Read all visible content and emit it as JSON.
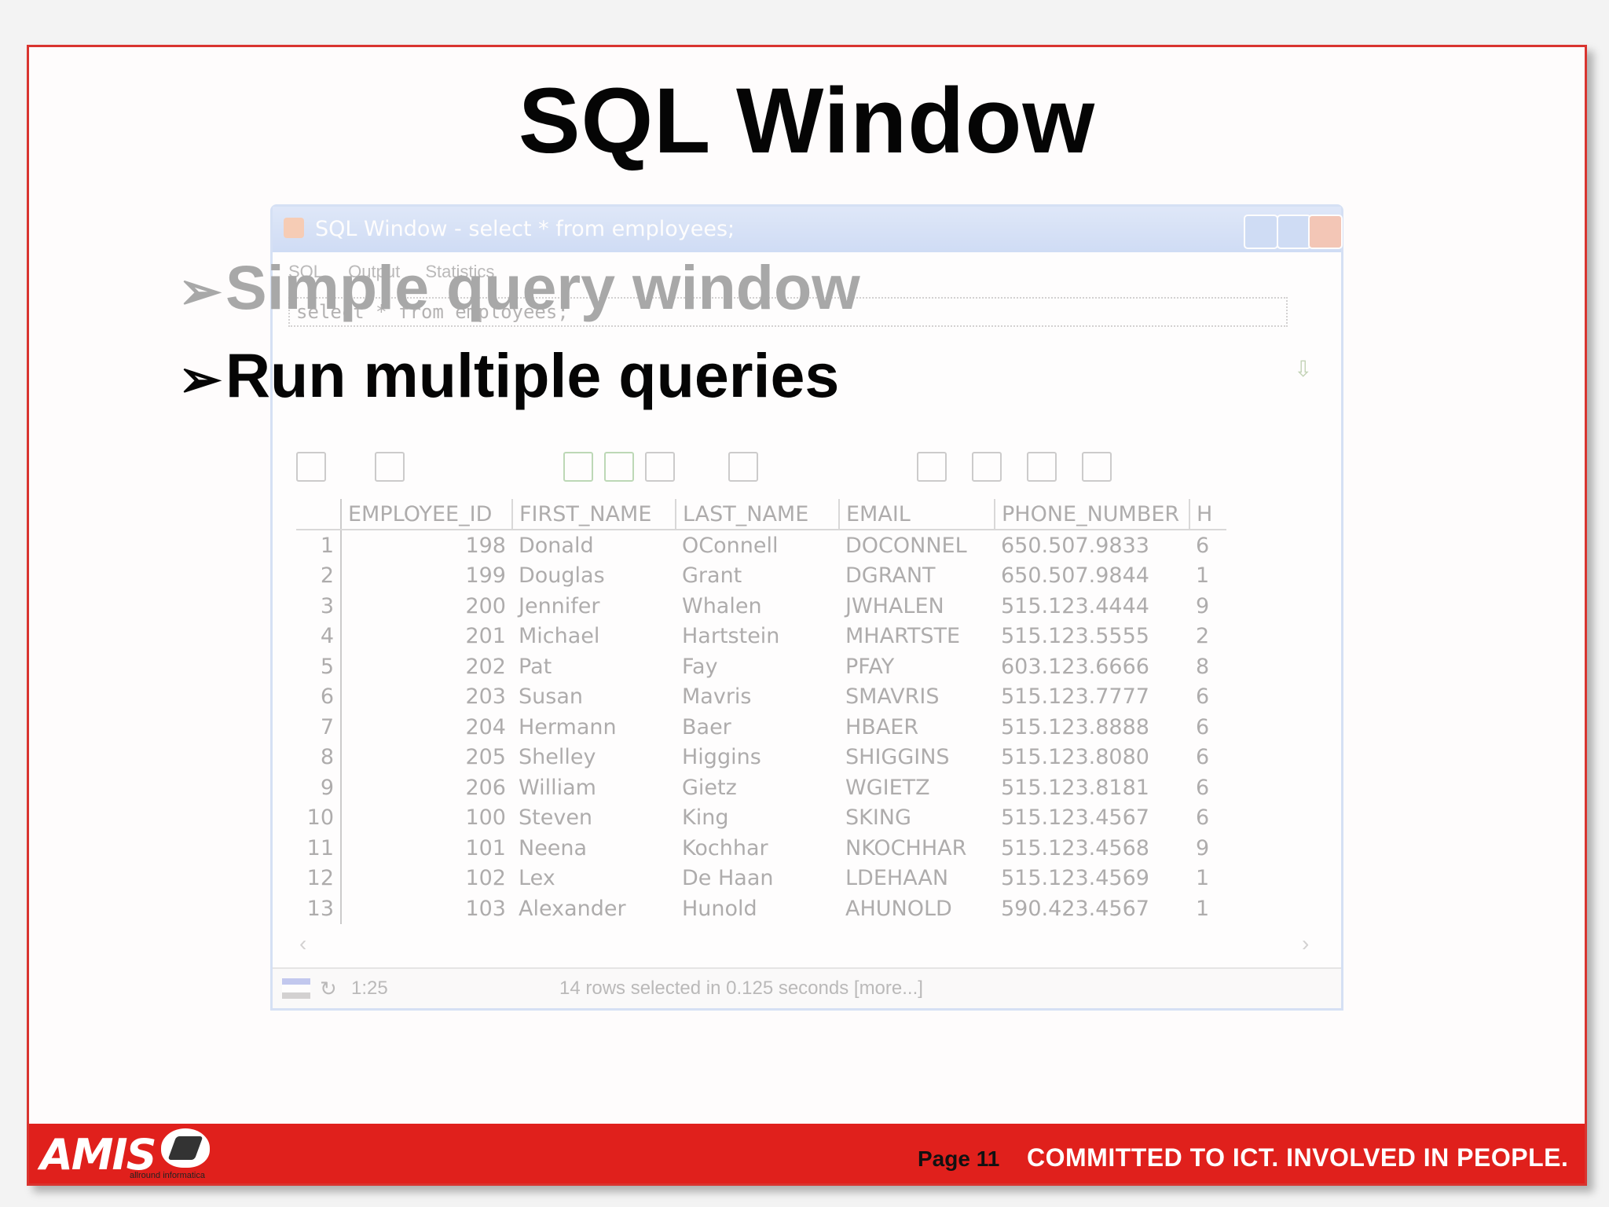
{
  "slide": {
    "title": "SQL Window",
    "bullets": [
      {
        "marker": "➢",
        "text": "Simple query window",
        "state": "faded"
      },
      {
        "marker": "➢",
        "text": "Run multiple queries",
        "state": "active"
      }
    ],
    "footer": {
      "logo_text": "AMIS",
      "logo_sub": "allround informatica",
      "page_label": "Page 11",
      "slogan": "COMMITTED TO ICT.  INVOLVED IN PEOPLE."
    }
  },
  "sql_window": {
    "title": "SQL Window - select * from employees;",
    "tabs": [
      "SQL",
      "Output",
      "Statistics"
    ],
    "sql_text": "select * from employees;",
    "columns": [
      "EMPLOYEE_ID",
      "FIRST_NAME",
      "LAST_NAME",
      "EMAIL",
      "PHONE_NUMBER",
      "H"
    ],
    "rows": [
      {
        "n": "1",
        "id": "198",
        "first": "Donald",
        "last": "OConnell",
        "email": "DOCONNEL",
        "phone": "650.507.9833",
        "h": "6"
      },
      {
        "n": "2",
        "id": "199",
        "first": "Douglas",
        "last": "Grant",
        "email": "DGRANT",
        "phone": "650.507.9844",
        "h": "1"
      },
      {
        "n": "3",
        "id": "200",
        "first": "Jennifer",
        "last": "Whalen",
        "email": "JWHALEN",
        "phone": "515.123.4444",
        "h": "9"
      },
      {
        "n": "4",
        "id": "201",
        "first": "Michael",
        "last": "Hartstein",
        "email": "MHARTSTE",
        "phone": "515.123.5555",
        "h": "2"
      },
      {
        "n": "5",
        "id": "202",
        "first": "Pat",
        "last": "Fay",
        "email": "PFAY",
        "phone": "603.123.6666",
        "h": "8"
      },
      {
        "n": "6",
        "id": "203",
        "first": "Susan",
        "last": "Mavris",
        "email": "SMAVRIS",
        "phone": "515.123.7777",
        "h": "6"
      },
      {
        "n": "7",
        "id": "204",
        "first": "Hermann",
        "last": "Baer",
        "email": "HBAER",
        "phone": "515.123.8888",
        "h": "6"
      },
      {
        "n": "8",
        "id": "205",
        "first": "Shelley",
        "last": "Higgins",
        "email": "SHIGGINS",
        "phone": "515.123.8080",
        "h": "6"
      },
      {
        "n": "9",
        "id": "206",
        "first": "William",
        "last": "Gietz",
        "email": "WGIETZ",
        "phone": "515.123.8181",
        "h": "6"
      },
      {
        "n": "10",
        "id": "100",
        "first": "Steven",
        "last": "King",
        "email": "SKING",
        "phone": "515.123.4567",
        "h": "6"
      },
      {
        "n": "11",
        "id": "101",
        "first": "Neena",
        "last": "Kochhar",
        "email": "NKOCHHAR",
        "phone": "515.123.4568",
        "h": "9"
      },
      {
        "n": "12",
        "id": "102",
        "first": "Lex",
        "last": "De Haan",
        "email": "LDEHAAN",
        "phone": "515.123.4569",
        "h": "1"
      },
      {
        "n": "13",
        "id": "103",
        "first": "Alexander",
        "last": "Hunold",
        "email": "AHUNOLD",
        "phone": "590.423.4567",
        "h": "1"
      }
    ],
    "status": {
      "position": "1:25",
      "message": "14 rows selected in 0.125 seconds [more...]"
    }
  }
}
